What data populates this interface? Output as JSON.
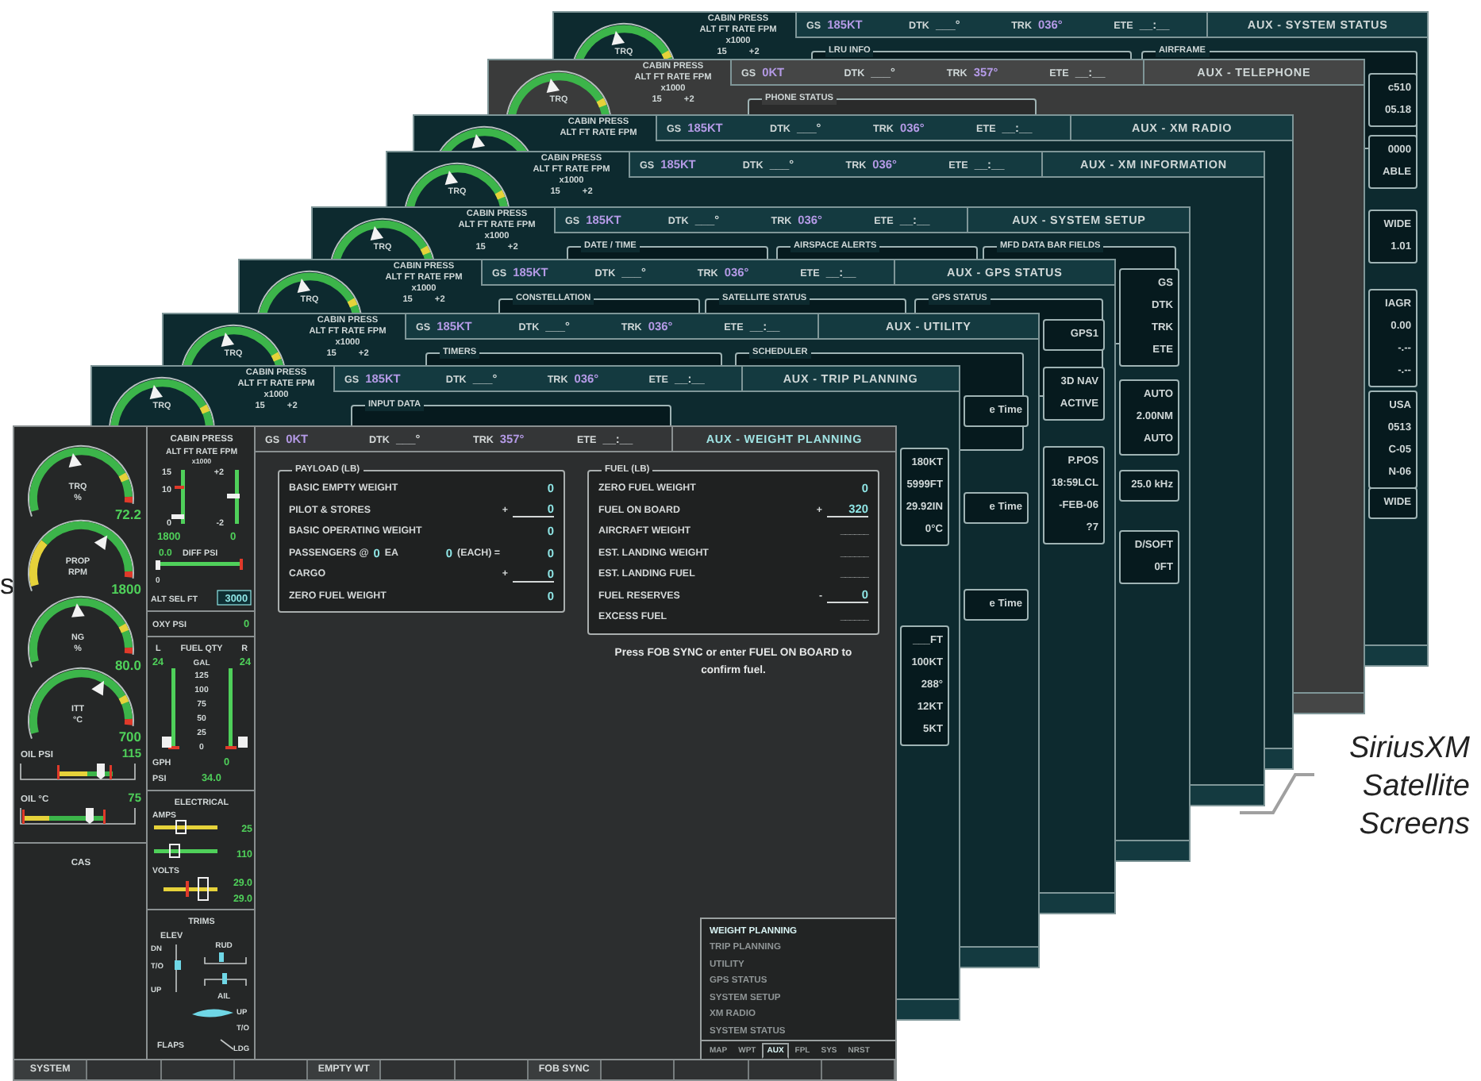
{
  "edge_label": "s",
  "screens": [
    {
      "kind": "teal",
      "engine_label": "TRQ",
      "cabin": [
        "CABIN PRESS",
        "ALT FT RATE FPM",
        "x1000"
      ],
      "cabin_ticks": [
        "15",
        "+2"
      ],
      "nav": [
        {
          "label": "GS",
          "value": "185KT",
          "kind": "data"
        },
        {
          "label": "DTK",
          "value": "___°",
          "kind": "plain"
        },
        {
          "label": "TRK",
          "value": "036°",
          "kind": "data"
        },
        {
          "label": "ETE",
          "value": "__:__",
          "kind": "plain"
        }
      ],
      "title": "AUX - SYSTEM STATUS",
      "sections": [
        "LRU INFO",
        "AIRFRAME"
      ],
      "side": [
        [
          "c510",
          "05.18"
        ],
        [
          "0000",
          "ABLE"
        ],
        [
          "WIDE",
          "1.01"
        ],
        [
          "IAGR",
          "0.00",
          "-.--",
          "-.--"
        ],
        [
          "USA",
          "0513",
          "C-05",
          "N-06"
        ],
        [
          "WIDE"
        ]
      ]
    },
    {
      "kind": "grey",
      "engine_label": "TRQ",
      "cabin": [
        "CABIN PRESS",
        "ALT FT RATE FPM",
        "x1000"
      ],
      "cabin_ticks": [
        "15",
        "+2"
      ],
      "nav": [
        {
          "label": "GS",
          "value": "0KT",
          "kind": "data"
        },
        {
          "label": "DTK",
          "value": "___°",
          "kind": "plain"
        },
        {
          "label": "TRK",
          "value": "357°",
          "kind": "data"
        },
        {
          "label": "ETE",
          "value": "__:__",
          "kind": "plain"
        }
      ],
      "title": "AUX - TELEPHONE",
      "sections": [
        "PHONE STATUS"
      ]
    },
    {
      "kind": "teal",
      "cabin": [
        "CABIN PRESS",
        "ALT FT RATE FPM"
      ],
      "nav": [
        {
          "label": "GS",
          "value": "185KT",
          "kind": "data"
        },
        {
          "label": "DTK",
          "value": "___°",
          "kind": "plain"
        },
        {
          "label": "TRK",
          "value": "036°",
          "kind": "data"
        },
        {
          "label": "ETE",
          "value": "__:__",
          "kind": "plain"
        }
      ],
      "title": "AUX - XM RADIO"
    },
    {
      "kind": "teal",
      "engine_label": "TRQ",
      "cabin": [
        "CABIN PRESS",
        "ALT FT RATE FPM",
        "x1000"
      ],
      "cabin_ticks": [
        "15",
        "+2"
      ],
      "nav": [
        {
          "label": "GS",
          "value": "185KT",
          "kind": "data"
        },
        {
          "label": "DTK",
          "value": "___°",
          "kind": "plain"
        },
        {
          "label": "TRK",
          "value": "036°",
          "kind": "data"
        },
        {
          "label": "ETE",
          "value": "__:__",
          "kind": "plain"
        }
      ],
      "title": "AUX - XM INFORMATION"
    },
    {
      "kind": "teal",
      "engine_label": "TRQ",
      "cabin": [
        "CABIN PRESS",
        "ALT FT RATE FPM",
        "x1000"
      ],
      "cabin_ticks": [
        "15",
        "+2"
      ],
      "nav": [
        {
          "label": "GS",
          "value": "185KT",
          "kind": "data"
        },
        {
          "label": "DTK",
          "value": "___°",
          "kind": "plain"
        },
        {
          "label": "TRK",
          "value": "036°",
          "kind": "data"
        },
        {
          "label": "ETE",
          "value": "__:__",
          "kind": "plain"
        }
      ],
      "title": "AUX - SYSTEM SETUP",
      "sections": [
        "DATE / TIME",
        "AIRSPACE ALERTS",
        "MFD DATA BAR FIELDS"
      ],
      "side": [
        [
          "GS",
          "DTK",
          "TRK",
          "ETE"
        ],
        [
          "AUTO",
          "2.00NM",
          "AUTO"
        ],
        [
          "25.0 kHz"
        ],
        [
          "D/SOFT",
          "0FT"
        ]
      ]
    },
    {
      "kind": "teal",
      "engine_label": "TRQ",
      "cabin": [
        "CABIN PRESS",
        "ALT FT RATE FPM",
        "x1000"
      ],
      "cabin_ticks": [
        "15",
        "+2"
      ],
      "nav": [
        {
          "label": "GS",
          "value": "185KT",
          "kind": "data"
        },
        {
          "label": "DTK",
          "value": "___°",
          "kind": "plain"
        },
        {
          "label": "TRK",
          "value": "036°",
          "kind": "data"
        },
        {
          "label": "ETE",
          "value": "__:__",
          "kind": "plain"
        }
      ],
      "title": "AUX - GPS STATUS",
      "sections": [
        "CONSTELLATION",
        "SATELLITE STATUS",
        "GPS STATUS"
      ],
      "side": [
        [
          "GPS1"
        ],
        [
          "3D NAV",
          "ACTIVE"
        ],
        [
          "P.POS",
          "18:59LCL",
          "-FEB-06",
          "?7"
        ]
      ]
    },
    {
      "kind": "teal",
      "engine_label": "TRQ",
      "cabin": [
        "CABIN PRESS",
        "ALT FT RATE FPM",
        "x1000"
      ],
      "cabin_ticks": [
        "15",
        "+2"
      ],
      "nav": [
        {
          "label": "GS",
          "value": "185KT",
          "kind": "data"
        },
        {
          "label": "DTK",
          "value": "___°",
          "kind": "plain"
        },
        {
          "label": "TRK",
          "value": "036°",
          "kind": "data"
        },
        {
          "label": "ETE",
          "value": "__:__",
          "kind": "plain"
        }
      ],
      "title": "AUX - UTILITY",
      "sections": [
        "TIMERS",
        "SCHEDULER"
      ],
      "side": [
        [
          "e Time"
        ],
        [
          "e Time"
        ],
        [
          "e Time"
        ]
      ]
    },
    {
      "kind": "teal",
      "engine_label": "TRQ",
      "cabin": [
        "CABIN PRESS",
        "ALT FT RATE FPM",
        "x1000"
      ],
      "cabin_ticks": [
        "15",
        "+2"
      ],
      "nav": [
        {
          "label": "GS",
          "value": "185KT",
          "kind": "data"
        },
        {
          "label": "DTK",
          "value": "___°",
          "kind": "plain"
        },
        {
          "label": "TRK",
          "value": "036°",
          "kind": "data"
        },
        {
          "label": "ETE",
          "value": "__:__",
          "kind": "plain"
        }
      ],
      "title": "AUX - TRIP PLANNING",
      "sections": [
        "INPUT DATA"
      ],
      "side": [
        [
          "180KT",
          "5999FT",
          "29.92IN",
          "0°C"
        ],
        [
          "___FT",
          "100KT",
          "288°",
          "12KT",
          "5KT"
        ]
      ]
    }
  ],
  "front": {
    "engine": {
      "gauges": [
        {
          "kind": "standard",
          "label": [
            "TRQ",
            "%"
          ],
          "value": "72.2"
        },
        {
          "kind": "low_caution",
          "label": [
            "PROP",
            "RPM"
          ],
          "value": "1800"
        },
        {
          "kind": "standard",
          "label": [
            "NG",
            "%"
          ],
          "value": "80.0"
        },
        {
          "kind": "standard",
          "label": [
            "ITT",
            "°C"
          ],
          "value": "700"
        }
      ],
      "bars": [
        {
          "label": "OIL PSI",
          "value": "115"
        },
        {
          "label": "OIL °C",
          "value": "75"
        }
      ],
      "cas": "CAS"
    },
    "cabin": {
      "title": "CABIN PRESS",
      "units": "ALT FT RATE FPM",
      "scale": "x1000",
      "alt_ticks": [
        "15",
        "10",
        "0"
      ],
      "rate_ticks": [
        "+2",
        "-2"
      ],
      "alt": "1800",
      "rate": "0",
      "diff": "0.0",
      "diff_label": "DIFF PSI",
      "diff_min": "0",
      "alt_sel_label": "ALT SEL FT",
      "alt_sel": "3000"
    },
    "oxy": {
      "label": "OXY PSI",
      "value": "0"
    },
    "fuel": {
      "left": "L",
      "title": "FUEL QTY",
      "right": "R",
      "left_qty": "24",
      "unit": "GAL",
      "right_qty": "24",
      "ticks": [
        "125",
        "100",
        "75",
        "50",
        "25",
        "0"
      ],
      "flow_label": "GPH",
      "flow": "0",
      "psi_label": "PSI",
      "psi": "34.0"
    },
    "electrical": {
      "title": "ELECTRICAL",
      "amps_label": "AMPS",
      "amps": [
        "25",
        "110"
      ],
      "volts_label": "VOLTS",
      "volts": [
        "29.0",
        "29.0"
      ]
    },
    "trims": {
      "title": "TRIMS",
      "elev": "ELEV",
      "elev_marks": [
        "DN",
        "T/O",
        "UP"
      ],
      "rud": "RUD",
      "ail": "AIL",
      "flap_marks": [
        "UP",
        "T/O"
      ],
      "flaps": "FLAPS",
      "ldg": "LDG"
    },
    "nav": [
      {
        "label": "GS",
        "value": "0KT",
        "kind": "data"
      },
      {
        "label": "DTK",
        "value": "___°",
        "kind": "plain"
      },
      {
        "label": "TRK",
        "value": "357°",
        "kind": "data"
      },
      {
        "label": "ETE",
        "value": "__:__",
        "kind": "plain"
      }
    ],
    "title": "AUX - WEIGHT PLANNING",
    "payload": {
      "title": "PAYLOAD (LB)",
      "rows": [
        {
          "kind": "value",
          "label": "BASIC EMPTY WEIGHT",
          "value": "0"
        },
        {
          "kind": "entry",
          "label": "PILOT & STORES",
          "sign": "+",
          "value": "0"
        },
        {
          "kind": "value",
          "label": "BASIC OPERATING WEIGHT",
          "value": "0"
        },
        {
          "kind": "passengers",
          "label": "PASSENGERS @",
          "count": "0",
          "count_unit": "EA",
          "each": "0",
          "each_label": "(EACH) =",
          "value": "0"
        },
        {
          "kind": "entry",
          "label": "CARGO",
          "sign": "+",
          "value": "0"
        },
        {
          "kind": "value",
          "label": "ZERO FUEL WEIGHT",
          "value": "0"
        }
      ]
    },
    "fuel_panel": {
      "title": "FUEL (LB)",
      "rows": [
        {
          "kind": "value",
          "label": "ZERO FUEL WEIGHT",
          "value": "0"
        },
        {
          "kind": "entry",
          "label": "FUEL ON BOARD",
          "sign": "+",
          "value": "320"
        },
        {
          "kind": "blank",
          "label": "AIRCRAFT WEIGHT",
          "value": "______"
        },
        {
          "kind": "blank",
          "label": "EST. LANDING WEIGHT",
          "value": "______"
        },
        {
          "kind": "blank",
          "label": "EST. LANDING FUEL",
          "value": "______"
        },
        {
          "kind": "entry",
          "label": "FUEL RESERVES",
          "sign": "-",
          "value": "0"
        },
        {
          "kind": "blank",
          "label": "EXCESS FUEL",
          "value": "______"
        }
      ]
    },
    "message": "Press FOB SYNC or enter FUEL ON BOARD to confirm fuel.",
    "menu": [
      {
        "label": "WEIGHT PLANNING",
        "selected": true
      },
      {
        "label": "TRIP PLANNING",
        "selected": false
      },
      {
        "label": "UTILITY",
        "selected": false
      },
      {
        "label": "GPS STATUS",
        "selected": false
      },
      {
        "label": "SYSTEM SETUP",
        "selected": false
      },
      {
        "label": "XM RADIO",
        "selected": false
      },
      {
        "label": "SYSTEM STATUS",
        "selected": false
      }
    ],
    "page_groups": [
      {
        "label": "MAP",
        "selected": false
      },
      {
        "label": "WPT",
        "selected": false
      },
      {
        "label": "AUX",
        "selected": true
      },
      {
        "label": "FPL",
        "selected": false
      },
      {
        "label": "SYS",
        "selected": false
      },
      {
        "label": "NRST",
        "selected": false
      }
    ],
    "softkeys": [
      {
        "kind": "labeled",
        "label": "SYSTEM"
      },
      {
        "kind": "blank"
      },
      {
        "kind": "blank"
      },
      {
        "kind": "blank"
      },
      {
        "kind": "labeled",
        "label": "EMPTY WT"
      },
      {
        "kind": "blank"
      },
      {
        "kind": "blank"
      },
      {
        "kind": "labeled",
        "label": "FOB SYNC"
      },
      {
        "kind": "blank"
      },
      {
        "kind": "blank"
      },
      {
        "kind": "blank"
      },
      {
        "kind": "blank"
      }
    ]
  },
  "callout": {
    "lines": [
      "SiriusXM",
      "Satellite",
      "Screens"
    ]
  }
}
